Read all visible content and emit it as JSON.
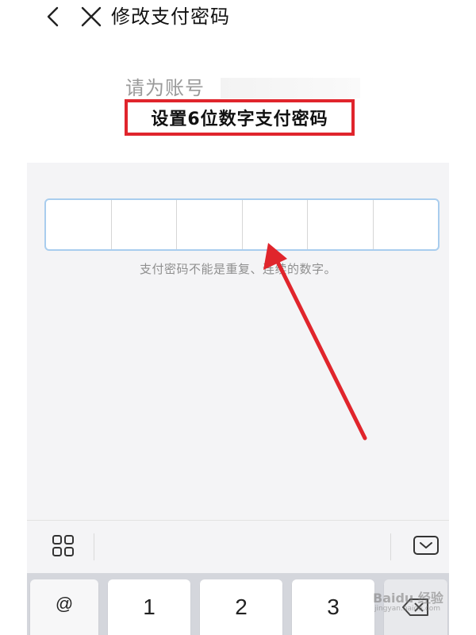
{
  "header": {
    "title": "修改支付密码",
    "back_icon": "chevron-left-icon",
    "close_icon": "close-icon"
  },
  "prompt": {
    "label": "请为账号",
    "headline": "设置6位数字支付密码"
  },
  "pin": {
    "length": 6,
    "hint": "支付密码不能是重复、连续的数字。"
  },
  "keyboard": {
    "keys": [
      "@",
      "1",
      "2",
      "3"
    ],
    "delete_icon": "backspace-icon",
    "grid_icon": "grid-icon",
    "hide_icon": "keyboard-hide-icon"
  },
  "watermark": {
    "text": "Baidu 经验",
    "url": "jingyan.baidu.com"
  },
  "colors": {
    "highlight_border": "#e0252c",
    "arrow": "#e0252c",
    "panel": "#f4f4f6",
    "pin_border": "#a9cdee"
  }
}
